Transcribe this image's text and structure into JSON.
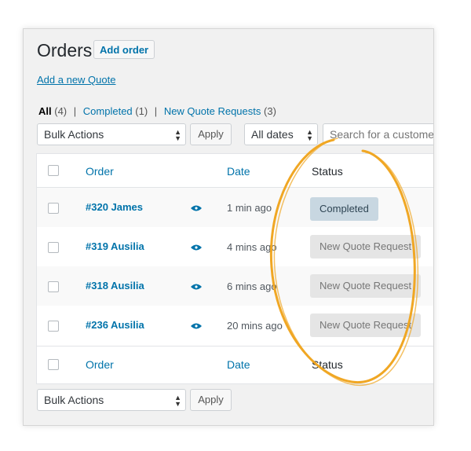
{
  "page": {
    "title": "Orders",
    "add_order_label": "Add order",
    "add_quote_link": "Add a new Quote"
  },
  "filters": [
    {
      "label": "All",
      "count": "(4)"
    },
    {
      "label": "Completed",
      "count": "(1)"
    },
    {
      "label": "New Quote Requests",
      "count": "(3)"
    }
  ],
  "filter_separator": "|",
  "top_actions": {
    "bulk_actions": "Bulk Actions",
    "apply": "Apply",
    "dates": "All dates",
    "search_placeholder": "Search for a customer"
  },
  "table": {
    "columns": {
      "order": "Order",
      "date": "Date",
      "status": "Status"
    },
    "rows": [
      {
        "order": "#320 James",
        "date": "1 min ago",
        "status": "Completed",
        "status_type": "completed"
      },
      {
        "order": "#319 Ausilia",
        "date": "4 mins ago",
        "status": "New Quote Request",
        "status_type": "quote"
      },
      {
        "order": "#318 Ausilia",
        "date": "6 mins ago",
        "status": "New Quote Request",
        "status_type": "quote"
      },
      {
        "order": "#236 Ausilia",
        "date": "20 mins ago",
        "status": "New Quote Request",
        "status_type": "quote"
      }
    ]
  },
  "bottom_actions": {
    "bulk_actions": "Bulk Actions",
    "apply": "Apply"
  },
  "icons": {
    "preview": "eye-icon",
    "select_arrows": "up-down-arrows-icon"
  },
  "colors": {
    "link": "#0073aa",
    "highlight": "#f0a724",
    "completed_badge": "#c8d7e1",
    "quote_badge": "#e5e5e5"
  }
}
